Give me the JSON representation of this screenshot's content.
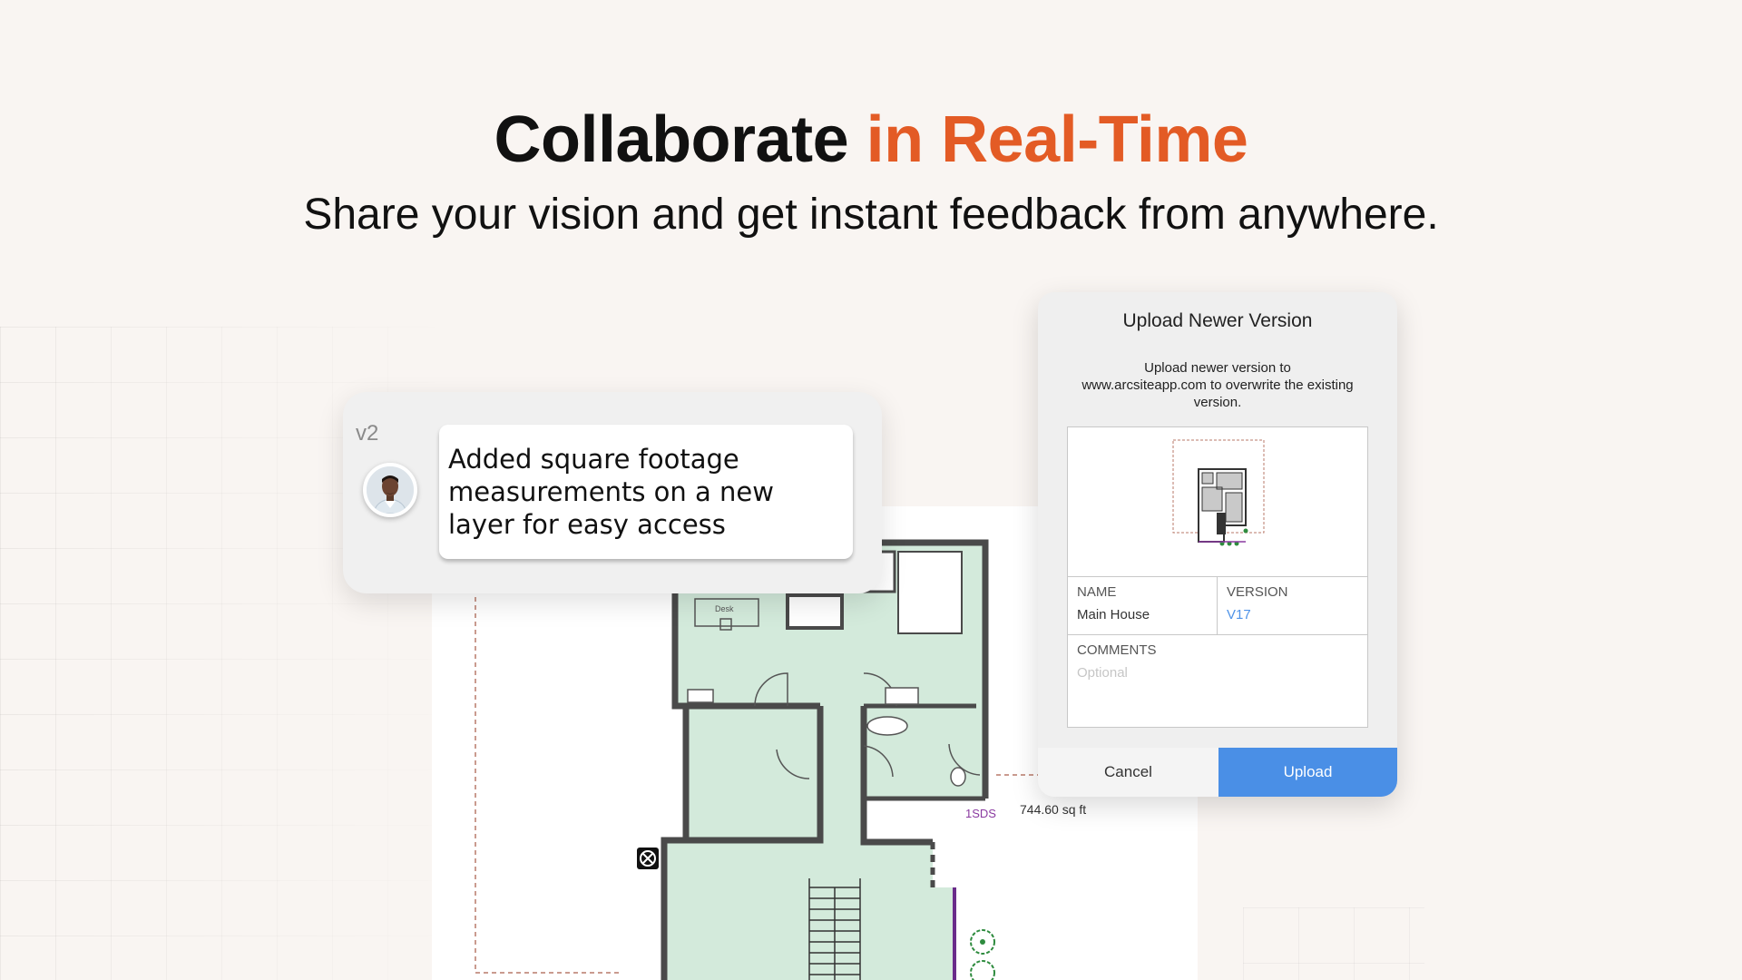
{
  "hero": {
    "title_main": "Collaborate",
    "title_accent": "in Real-Time",
    "subtitle": "Share your vision and get instant feedback from anywhere."
  },
  "comment": {
    "version": "v2",
    "text": "Added square footage measurements on a new layer for easy access"
  },
  "floorplan": {
    "desk_label": "Desk",
    "layer_label": "1SDS",
    "area_label": "744.60 sq ft"
  },
  "dialog": {
    "title": "Upload Newer Version",
    "message": "Upload newer version to www.arcsiteapp.com to overwrite the existing version.",
    "name_label": "NAME",
    "name_value": "Main House",
    "version_label": "VERSION",
    "version_value": "V17",
    "comments_label": "COMMENTS",
    "comments_placeholder": "Optional",
    "cancel_label": "Cancel",
    "upload_label": "Upload"
  },
  "colors": {
    "accent": "#e35b25",
    "room_fill": "#d3eadb",
    "wall": "#4a4a4a",
    "upload_button": "#4a8fe6"
  }
}
